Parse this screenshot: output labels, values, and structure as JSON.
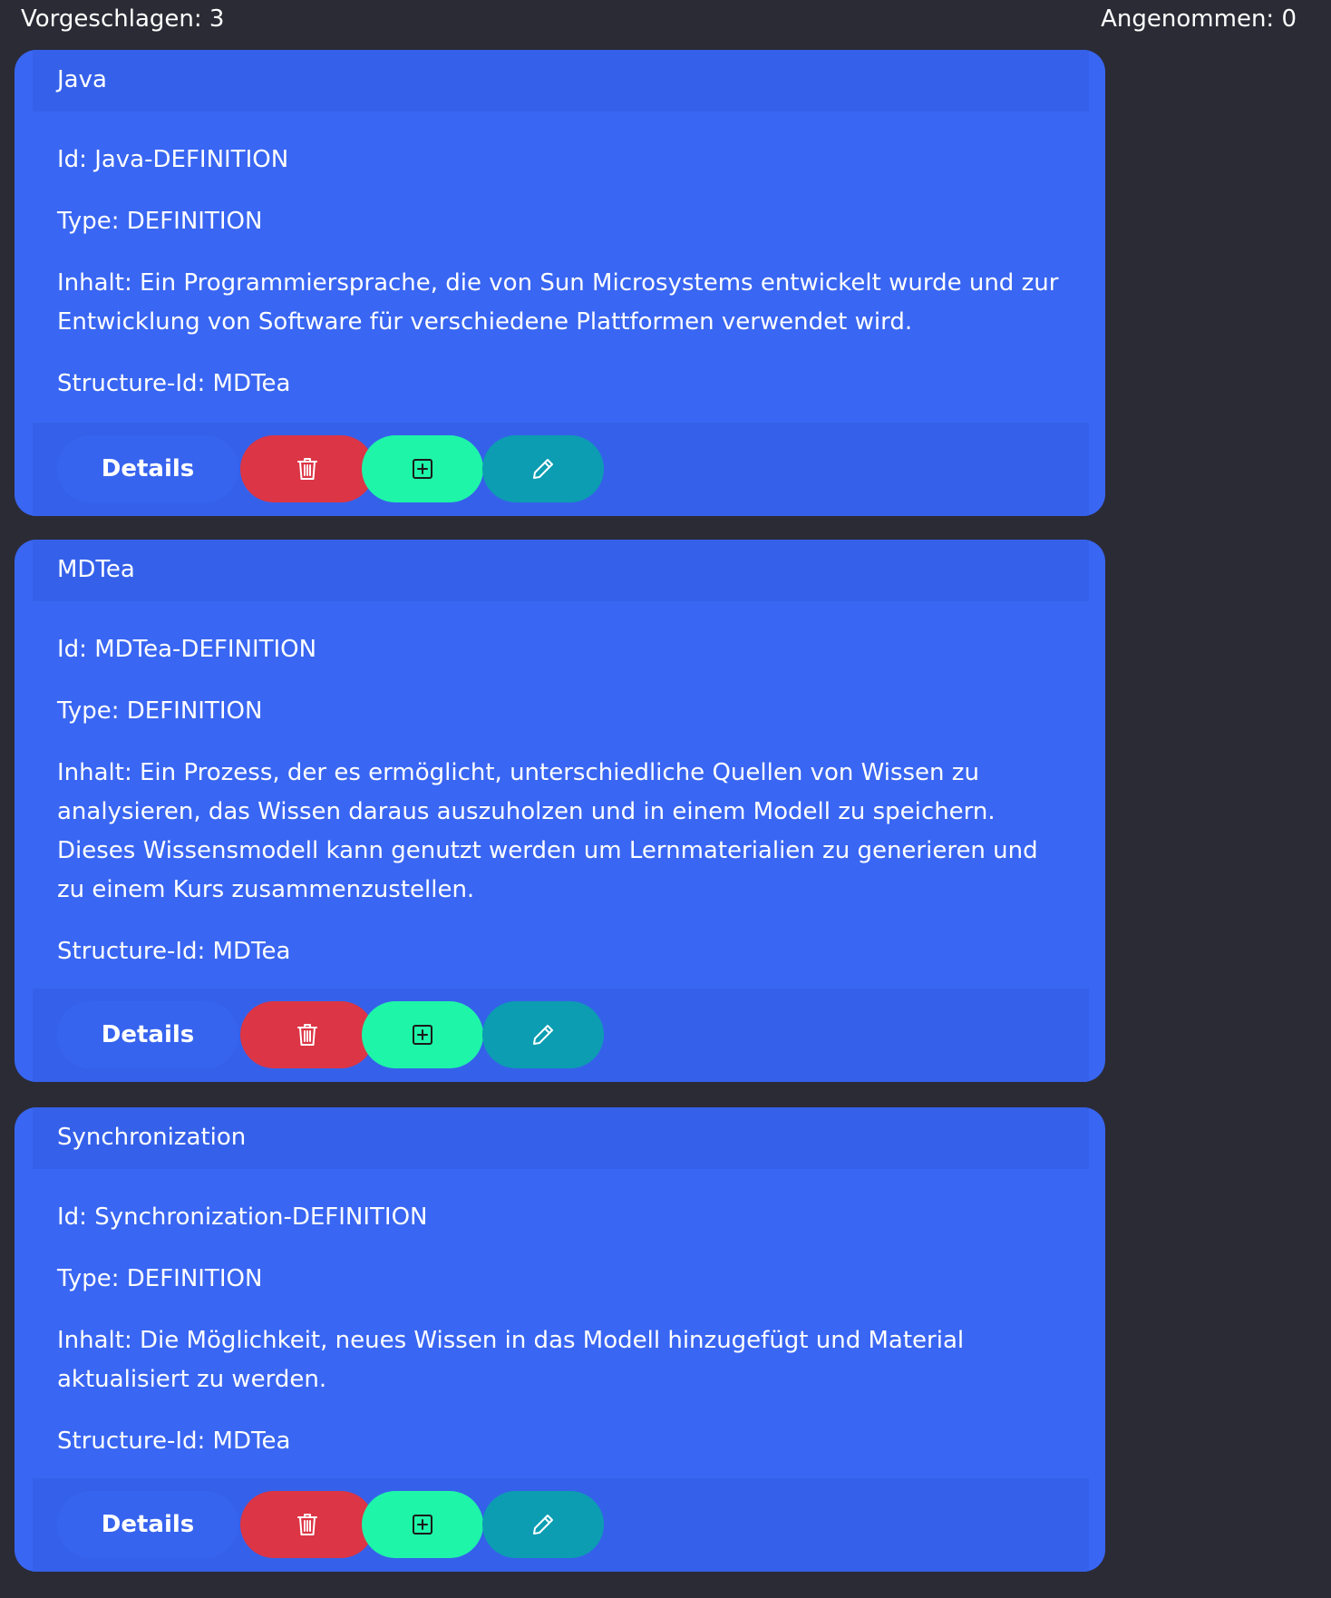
{
  "counts": {
    "suggested": "Vorgeschlagen: 3",
    "accepted": "Angenommen: 0"
  },
  "cards": [
    {
      "title": "Java",
      "id": "Id: Java-DEFINITION",
      "type": "Type: DEFINITION",
      "content": "Inhalt: Ein Programmiersprache, die von Sun Microsystems entwickelt wurde und zur Entwicklung von Software für verschiedene Plattformen verwendet wird.",
      "structure": "Structure-Id: MDTea",
      "details_label": "Details"
    },
    {
      "title": "MDTea",
      "id": "Id: MDTea-DEFINITION",
      "type": "Type: DEFINITION",
      "content": "Inhalt: Ein Prozess, der es ermöglicht, unterschiedliche Quellen von Wissen zu analysieren, das Wissen daraus auszuholzen und in einem Modell zu speichern. Dieses Wissensmodell kann genutzt werden um Lernmaterialien zu generieren und zu einem Kurs zusammenzustellen.",
      "structure": "Structure-Id: MDTea",
      "details_label": "Details"
    },
    {
      "title": "Synchronization",
      "id": "Id: Synchronization-DEFINITION",
      "type": "Type: DEFINITION",
      "content": "Inhalt: Die Möglichkeit, neues Wissen in das Modell hinzugefügt und Material aktualisiert zu werden.",
      "structure": "Structure-Id: MDTea",
      "details_label": "Details"
    }
  ],
  "icons": {
    "delete": "trash-icon",
    "add": "plus-square-icon",
    "edit": "pencil-icon"
  },
  "colors": {
    "background": "#2b2b36",
    "card": "#3966f2",
    "card_band": "#3561ea",
    "delete": "#dc3545",
    "add": "#1ef5a8",
    "edit": "#0c9db2"
  }
}
